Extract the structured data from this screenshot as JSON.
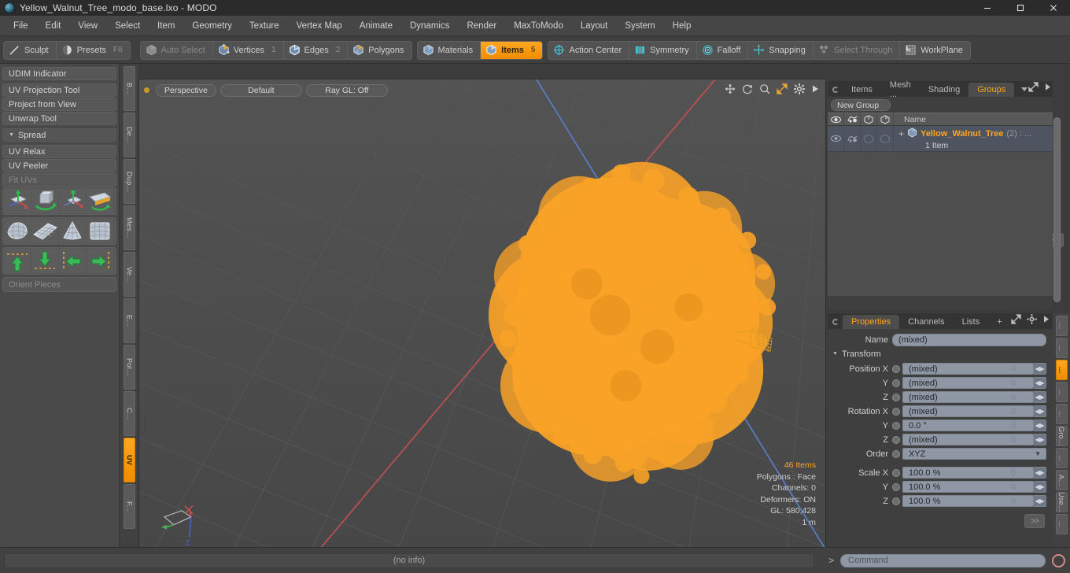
{
  "window": {
    "title": "Yellow_Walnut_Tree_modo_base.lxo - MODO",
    "logo_icon": "modo-logo-icon",
    "minimize_icon": "minimize-icon",
    "maximize_icon": "maximize-icon",
    "close_icon": "close-icon"
  },
  "menubar": {
    "items": [
      {
        "label": "File"
      },
      {
        "label": "Edit"
      },
      {
        "label": "View"
      },
      {
        "label": "Select"
      },
      {
        "label": "Item"
      },
      {
        "label": "Geometry"
      },
      {
        "label": "Texture"
      },
      {
        "label": "Vertex Map"
      },
      {
        "label": "Animate"
      },
      {
        "label": "Dynamics"
      },
      {
        "label": "Render"
      },
      {
        "label": "MaxToModo"
      },
      {
        "label": "Layout"
      },
      {
        "label": "System"
      },
      {
        "label": "Help"
      }
    ]
  },
  "toolbar": {
    "group_left": [
      {
        "label": "Sculpt",
        "icon": "sculpt-icon",
        "badge": "",
        "state": "normal"
      },
      {
        "label": "Presets",
        "icon": "presets-icon",
        "badge": "F6",
        "state": "normal"
      }
    ],
    "group_select": [
      {
        "label": "Auto Select",
        "icon": "cube-grey-icon",
        "badge": "",
        "state": "dim"
      },
      {
        "label": "Vertices",
        "icon": "cube-vertices-icon",
        "badge": "1",
        "state": "normal"
      },
      {
        "label": "Edges",
        "icon": "cube-edges-icon",
        "badge": "2",
        "state": "normal"
      },
      {
        "label": "Polygons",
        "icon": "cube-polygons-icon",
        "badge": "",
        "state": "normal"
      }
    ],
    "group_items": [
      {
        "label": "Materials",
        "icon": "cube-materials-icon",
        "badge": "",
        "state": "normal"
      },
      {
        "label": "Items",
        "icon": "cube-items-icon",
        "badge": "5",
        "state": "active"
      }
    ],
    "group_right": [
      {
        "label": "Action Center",
        "icon": "action-center-icon",
        "badge": "",
        "state": "normal"
      },
      {
        "label": "Symmetry",
        "icon": "symmetry-icon",
        "badge": "",
        "state": "normal"
      },
      {
        "label": "Falloff",
        "icon": "falloff-icon",
        "badge": "",
        "state": "normal"
      },
      {
        "label": "Snapping",
        "icon": "snapping-icon",
        "badge": "",
        "state": "normal"
      },
      {
        "label": "Select Through",
        "icon": "select-through-icon",
        "badge": "",
        "state": "dim"
      },
      {
        "label": "WorkPlane",
        "icon": "workplane-icon",
        "badge": "",
        "state": "normal"
      }
    ]
  },
  "left_panel": {
    "rows": [
      {
        "label": "UDIM Indicator",
        "type": "button",
        "state": "normal"
      },
      {
        "label": "UV Projection Tool",
        "type": "button",
        "state": "normal"
      },
      {
        "label": "Project from View",
        "type": "button",
        "state": "normal"
      },
      {
        "label": "Unwrap Tool",
        "type": "button",
        "state": "normal"
      },
      {
        "label": "Spread",
        "type": "group",
        "state": "normal"
      },
      {
        "label": "UV Relax",
        "type": "button",
        "state": "normal"
      },
      {
        "label": "UV Peeler",
        "type": "button",
        "state": "normal"
      },
      {
        "label": "Fit UVs",
        "type": "button",
        "state": "dim"
      }
    ],
    "icon_grid_1": [
      "move-axis-icon",
      "rotate-cube-icon",
      "scale-axis-icon",
      "flip-plane-icon"
    ],
    "icon_grid_2": [
      "uv-sphere-map-icon",
      "uv-planar-grid-icon",
      "uv-cone-map-icon",
      "uv-cylinder-map-icon"
    ],
    "icon_grid_3": [
      "align-up-icon",
      "align-down-icon",
      "align-left-icon",
      "align-right-icon"
    ],
    "orient_field": "Orient Pieces",
    "more_button": ">>",
    "vertical_tabs": [
      {
        "label": "B...",
        "active": false
      },
      {
        "label": "De...",
        "active": false
      },
      {
        "label": "Dup...",
        "active": false
      },
      {
        "label": "Mes...",
        "active": false
      },
      {
        "label": "Ve...",
        "active": false
      },
      {
        "label": "E...",
        "active": false
      },
      {
        "label": "Pol...",
        "active": false
      },
      {
        "label": "C...",
        "active": false
      },
      {
        "label": "UV",
        "active": true
      },
      {
        "label": "F...",
        "active": false
      }
    ]
  },
  "viewport": {
    "buttons": [
      {
        "label": "Perspective"
      },
      {
        "label": "Default"
      },
      {
        "label": "Ray GL: Off"
      }
    ],
    "icons": [
      "move-tool-icon",
      "rotate-tool-icon",
      "zoom-tool-icon",
      "maximize-view-icon",
      "gear-icon",
      "play-arrow-icon"
    ],
    "stats": {
      "items": "46 Items",
      "polygons": "Polygons : Face",
      "channels": "Channels: 0",
      "deformers": "Deformers: ON",
      "gl": "GL: 580,428",
      "scale": "1 m"
    },
    "axis_gizmo": {
      "x": "X",
      "y": "Y",
      "z": "Z"
    }
  },
  "item_list_panel": {
    "tabs": [
      {
        "label": "Items",
        "active": false
      },
      {
        "label": "Mesh ...",
        "active": false
      },
      {
        "label": "Shading",
        "active": false
      },
      {
        "label": "Groups",
        "active": true
      }
    ],
    "tab_dropdown_icon": "chevron-down-icon",
    "expand_icon": "expand-panel-icon",
    "overflow_icon": "play-arrow-icon",
    "new_group_button": "New Group",
    "columns": [
      {
        "icon": "eye-icon"
      },
      {
        "icon": "render-visibility-icon"
      },
      {
        "icon": "lock-shade-icon"
      },
      {
        "icon": "shade-icon"
      },
      {
        "label": "Name"
      }
    ],
    "rows": [
      {
        "expander": "+",
        "item_icon": "mesh-item-icon",
        "name": "Yellow_Walnut_Tree",
        "suffix": "(2) : ...",
        "subtitle": "1 Item"
      }
    ]
  },
  "properties_panel": {
    "tabs": [
      {
        "label": "Properties",
        "active": true
      },
      {
        "label": "Channels",
        "active": false
      },
      {
        "label": "Lists",
        "active": false
      },
      {
        "label": "+",
        "active": false
      }
    ],
    "expand_icon": "expand-panel-icon",
    "gear_icon": "gear-icon",
    "overflow_icon": "play-arrow-icon",
    "name_label": "Name",
    "name_value": "(mixed)",
    "transform_section": "Transform",
    "fields": [
      {
        "label": "Position X",
        "value": "(mixed)",
        "zero": "0"
      },
      {
        "label": "Y",
        "value": "(mixed)",
        "zero": "0"
      },
      {
        "label": "Z",
        "value": "(mixed)",
        "zero": "0"
      },
      {
        "label": "Rotation X",
        "value": "(mixed)",
        "zero": "0"
      },
      {
        "label": "Y",
        "value": "0.0 °",
        "zero": "0"
      },
      {
        "label": "Z",
        "value": "(mixed)",
        "zero": "0"
      }
    ],
    "order_label": "Order",
    "order_value": "XYZ",
    "scale_fields": [
      {
        "label": "Scale X",
        "value": "100.0 %",
        "zero": "0"
      },
      {
        "label": "Y",
        "value": "100.0 %",
        "zero": "0"
      },
      {
        "label": "Z",
        "value": "100.0 %",
        "zero": "0"
      }
    ],
    "more_button": ">>"
  },
  "right_vertical_tabs": [
    {
      "label": "...",
      "active": false
    },
    {
      "label": "...",
      "active": false
    },
    {
      "label": "...",
      "active": true
    },
    {
      "label": "...",
      "active": false
    },
    {
      "label": "...",
      "active": false
    },
    {
      "label": "Gro...",
      "active": false
    },
    {
      "label": "...",
      "active": false
    },
    {
      "label": "A...",
      "active": false
    },
    {
      "label": "Use...",
      "active": false
    },
    {
      "label": "...",
      "active": false
    }
  ],
  "statusbar": {
    "info": "(no info)"
  },
  "command_bar": {
    "chevron": ">",
    "placeholder": "Command",
    "record_icon": "record-circle-icon"
  },
  "colors": {
    "accent": "#ffa520",
    "tree": "#f9a227",
    "axis_x": "#c24a4a",
    "axis_z": "#4a62c2",
    "viewport_bg": "#4d4d4d"
  }
}
